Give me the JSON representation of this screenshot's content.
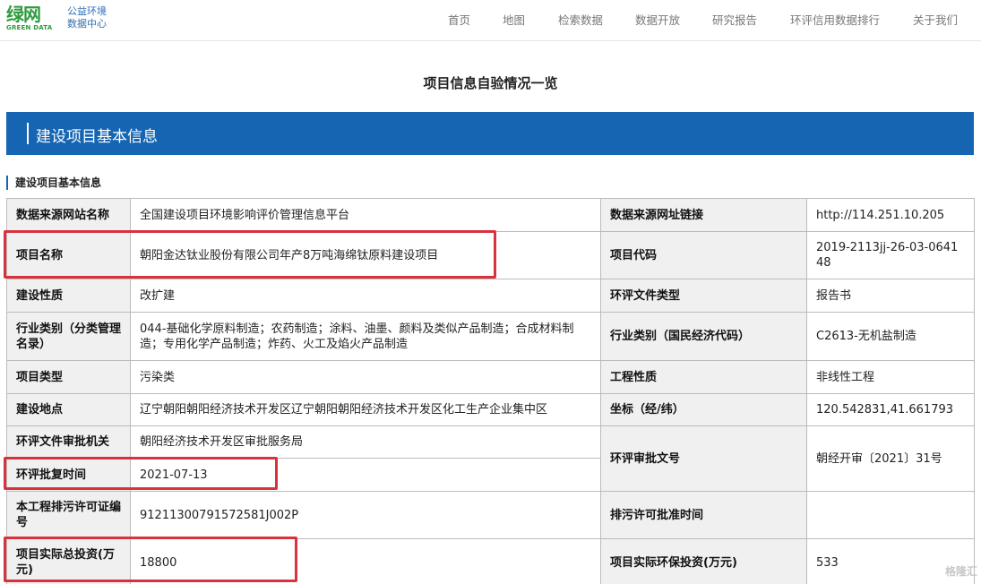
{
  "header": {
    "logo_mark": "绿网",
    "logo_sub": "GREEN DATA",
    "logo_text_line1": "公益环境",
    "logo_text_line2": "数据中心",
    "nav": [
      "首页",
      "地图",
      "检索数据",
      "数据开放",
      "研究报告",
      "环评信用数据排行",
      "关于我们"
    ]
  },
  "page": {
    "title": "项目信息自验情况一览",
    "banner": "建设项目基本信息",
    "section_label": "建设项目基本信息"
  },
  "rows": [
    {
      "l1": "数据来源网站名称",
      "v1": "全国建设项目环境影响评价管理信息平台",
      "l2": "数据来源网址链接",
      "v2": "http://114.251.10.205"
    },
    {
      "l1": "项目名称",
      "v1": "朝阳金达钛业股份有限公司年产8万吨海绵钛原料建设项目",
      "l2": "项目代码",
      "v2": "2019-2113jj-26-03-064148"
    },
    {
      "l1": "建设性质",
      "v1": "改扩建",
      "l2": "环评文件类型",
      "v2": "报告书"
    },
    {
      "l1": "行业类别（分类管理名录）",
      "v1": "044-基础化学原料制造；农药制造；涂料、油墨、颜料及类似产品制造；合成材料制造；专用化学产品制造；炸药、火工及焰火产品制造",
      "l2": "行业类别（国民经济代码）",
      "v2": "C2613-无机盐制造"
    },
    {
      "l1": "项目类型",
      "v1": "污染类",
      "l2": "工程性质",
      "v2": "非线性工程"
    },
    {
      "l1": "建设地点",
      "v1": "辽宁朝阳朝阳经济技术开发区辽宁朝阳朝阳经济技术开发区化工生产企业集中区",
      "l2": "坐标（经/纬）",
      "v2": "120.542831,41.661793"
    },
    {
      "l1": "环评文件审批机关",
      "v1": "朝阳经济技术开发区审批服务局",
      "l2": "环评审批文号",
      "v2": "朝经开审〔2021〕31号"
    },
    {
      "l1": "环评批复时间",
      "v1": "2021-07-13"
    },
    {
      "l1": "本工程排污许可证编号",
      "v1": "91211300791572581J002P",
      "l2": "排污许可批准时间",
      "v2": ""
    },
    {
      "l1": "项目实际总投资(万元)",
      "v1": "18800",
      "l2": "项目实际环保投资(万元)",
      "v2": "533"
    }
  ],
  "watermark": "格隆汇"
}
